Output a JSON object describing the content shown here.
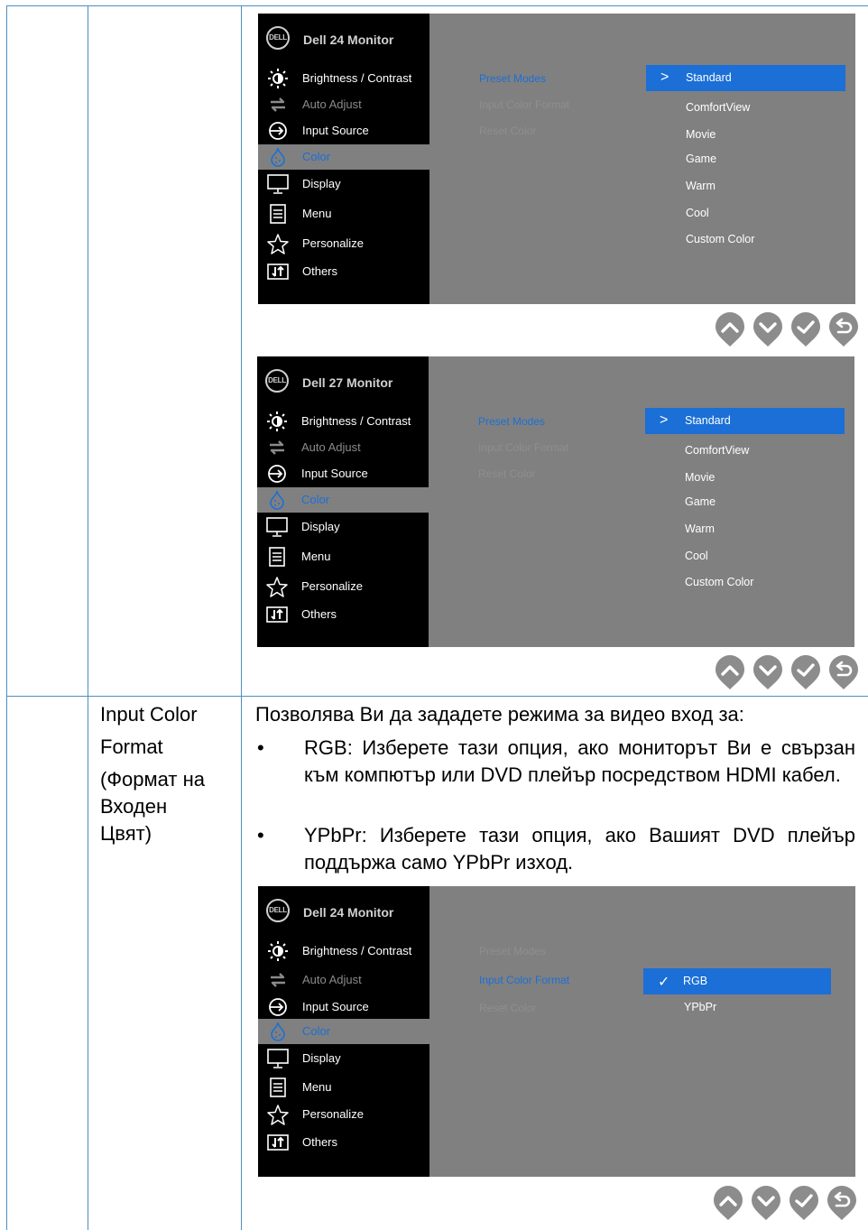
{
  "osd_common": {
    "menu_items": [
      {
        "label": "Brightness / Contrast",
        "icon": "brightness-icon",
        "state": "normal"
      },
      {
        "label": "Auto Adjust",
        "icon": "auto-adjust-icon",
        "state": "dim"
      },
      {
        "label": "Input Source",
        "icon": "input-source-icon",
        "state": "normal"
      },
      {
        "label": "Color",
        "icon": "color-icon",
        "state": "selected"
      },
      {
        "label": "Display",
        "icon": "display-icon",
        "state": "normal"
      },
      {
        "label": "Menu",
        "icon": "menu-icon",
        "state": "normal"
      },
      {
        "label": "Personalize",
        "icon": "personalize-icon",
        "state": "normal"
      },
      {
        "label": "Others",
        "icon": "others-icon",
        "state": "normal"
      }
    ],
    "logo": "DELL",
    "submenu": [
      "Preset Modes",
      "Input Color Format",
      "Reset Color"
    ],
    "nav_buttons": [
      "up-button",
      "down-button",
      "ok-button",
      "back-button"
    ]
  },
  "osd1": {
    "title": "Dell 24 Monitor",
    "active_sub": "Preset Modes",
    "selected_option": "Standard",
    "options": [
      "ComfortView",
      "Movie",
      "Game",
      "Warm",
      "Cool",
      "Custom Color"
    ]
  },
  "osd2": {
    "title": "Dell 27 Monitor",
    "active_sub": "Preset Modes",
    "selected_option": "Standard",
    "options": [
      "ComfortView",
      "Movie",
      "Game",
      "Warm",
      "Cool",
      "Custom Color"
    ]
  },
  "osd3": {
    "title": "Dell 24 Monitor",
    "active_sub": "Input Color Format",
    "selected_option": "RGB",
    "options": [
      "YPbPr"
    ]
  },
  "row2": {
    "name_lines": [
      "Input Color",
      "Format",
      "(Формат на",
      "Входен",
      "Цвят)"
    ],
    "intro": "Позволява Ви да зададете режима за видео вход за:",
    "bullet1_term": "RGB",
    "bullet1_text": ": Изберете тази опция, ако мониторът Ви е свързан към компютър или DVD плейър посредством HDMI кабел.",
    "bullet2_term": "YPbPr",
    "bullet2_text": ": Изберете тази опция, ако Вашият DVD плейър поддържа само YPbPr изход."
  },
  "colors": {
    "accent": "#1b6fd6",
    "osd_bg": "#808080",
    "rule": "#4d8fbf"
  }
}
